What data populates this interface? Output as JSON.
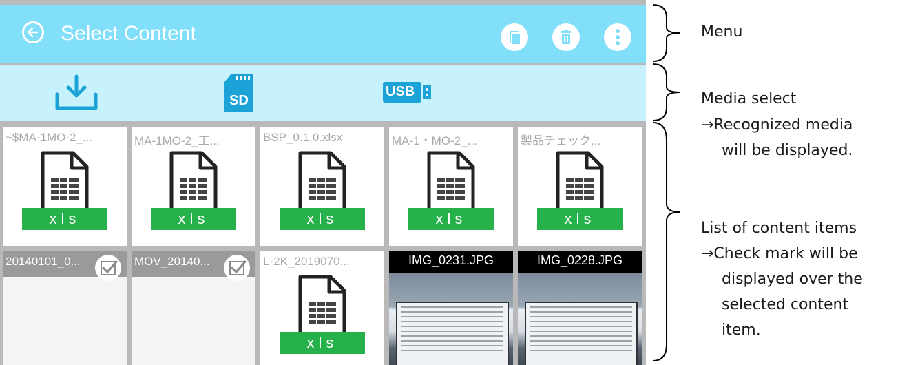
{
  "appbar": {
    "title": "Select Content",
    "back_icon": "back-arrow-icon",
    "actions": [
      "copy-icon",
      "trash-icon",
      "more-vert-icon"
    ],
    "color": "#82dffa"
  },
  "media_bar": {
    "items": [
      "download-icon",
      "sd-card-icon",
      "usb-icon"
    ],
    "sd_label": "SD",
    "usb_label": "USB",
    "color": "#c7f2fd"
  },
  "tiles": [
    {
      "name": "~$MA-1MO-2_...",
      "type": "xls"
    },
    {
      "name": "MA-1MO-2_工...",
      "type": "xls"
    },
    {
      "name": "BSP_0.1.0.xlsx",
      "type": "xls"
    },
    {
      "name": "MA-1・MO-2_...",
      "type": "xls"
    },
    {
      "name": "製品チェック...",
      "type": "xls"
    },
    {
      "name": "20140101_0...",
      "type": "video",
      "selected": true
    },
    {
      "name": "MOV_20140...",
      "type": "video",
      "selected": true
    },
    {
      "name": "L-2K_2019070...",
      "type": "xls"
    },
    {
      "name": "IMG_0231.JPG",
      "type": "image"
    },
    {
      "name": "IMG_0228.JPG",
      "type": "image"
    }
  ],
  "xls_label": "xls",
  "annotations": {
    "menu": "Menu",
    "media_select_1": "Media select",
    "media_select_2": "→Recognized media",
    "media_select_3": "will be displayed.",
    "list_1": "List of content items",
    "list_2": "→Check mark will be",
    "list_3": "displayed over the",
    "list_4": "selected content",
    "list_5": "item."
  },
  "colors": {
    "xls_green": "#27b14b",
    "sd_blue": "#1ba3d8"
  }
}
